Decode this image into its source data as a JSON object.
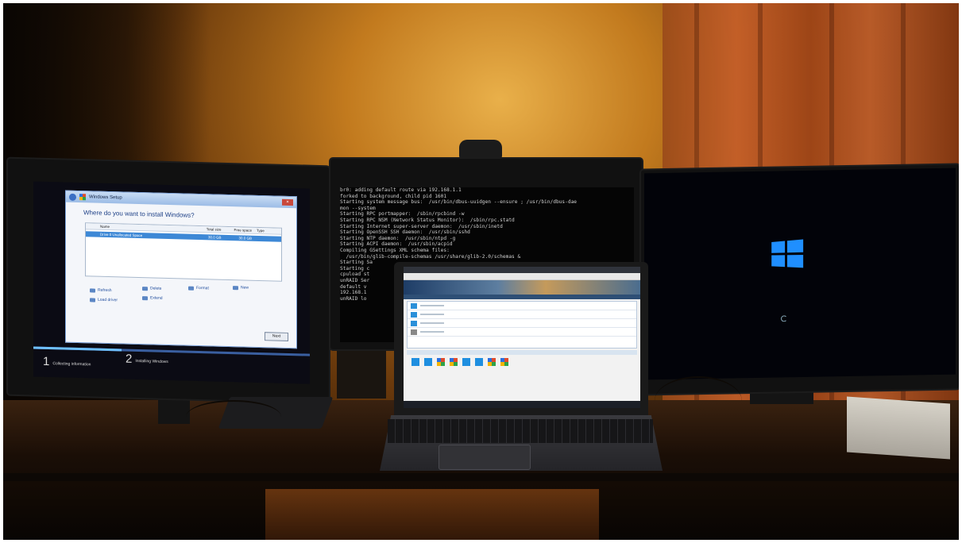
{
  "setup": {
    "title": "Windows Setup",
    "question": "Where do you want to install Windows?",
    "columns": [
      "Name",
      "Total size",
      "Free space",
      "Type"
    ],
    "drive": {
      "name": "Drive 0 Unallocated Space",
      "total": "30.0 GB",
      "free": "30.0 GB",
      "type": ""
    },
    "actions": {
      "refresh": "Refresh",
      "delete": "Delete",
      "format": "Format",
      "new": "New",
      "load_driver": "Load driver",
      "extend": "Extend"
    },
    "next": "Next",
    "steps": [
      {
        "num": "1",
        "label": "Collecting information"
      },
      {
        "num": "2",
        "label": "Installing Windows"
      }
    ],
    "progress": 0.32
  },
  "console": {
    "lines": [
      "br0: adding default route via 192.168.1.1",
      "forked to background, child pid 1601",
      "Starting system message bus:  /usr/bin/dbus-uuidgen --ensure ; /usr/bin/dbus-dae",
      "mon --system",
      "Starting RPC portmapper:  /sbin/rpcbind -w",
      "Starting RPC NSM (Network Status Monitor):  /sbin/rpc.statd",
      "Starting Internet super-server daemon:  /usr/sbin/inetd",
      "Starting OpenSSH SSH daemon:  /usr/sbin/sshd",
      "Starting NTP daemon:  /usr/sbin/ntpd -g",
      "Starting ACPI daemon:  /usr/sbin/acpid",
      "Compiling GSettings XML schema files:",
      "  /usr/bin/glib-compile-schemas /usr/share/glib-2.0/schemas &",
      "Starting Sa",
      "",
      "Starting c",
      "cpuload st",
      "",
      "unRAID Ser",
      "",
      "default v",
      "192.168.1",
      "",
      "unRAID lo"
    ]
  },
  "colors": {
    "win10_blue": "#1f8fff",
    "setup_blue": "#3d88d6",
    "lamp_glow": "#e9b04a"
  },
  "icons": [
    "windows-logo-icon",
    "back-arrow-icon",
    "refresh-icon",
    "delete-icon",
    "format-icon",
    "new-icon",
    "load-driver-icon",
    "extend-icon",
    "loading-spinner-icon"
  ]
}
